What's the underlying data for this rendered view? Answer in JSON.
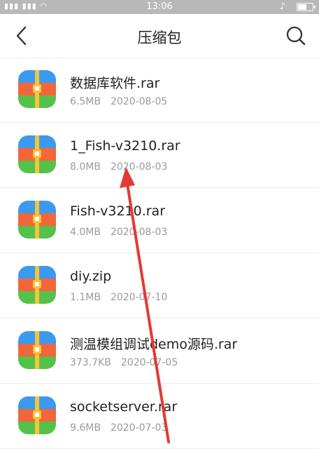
{
  "status": {
    "time": "13:06",
    "signal": "4G",
    "wifi": "wifi-icon",
    "mute": "bell-off-icon"
  },
  "header": {
    "title": "压缩包",
    "back_icon": "back-arrow-icon",
    "search_icon": "search-icon"
  },
  "files": [
    {
      "name": "数据库软件.rar",
      "size": "6.5MB",
      "date": "2020-08-05"
    },
    {
      "name": "1_Fish-v3210.rar",
      "size": "8.0MB",
      "date": "2020-08-03"
    },
    {
      "name": "Fish-v3210.rar",
      "size": "4.0MB",
      "date": "2020-08-03"
    },
    {
      "name": "diy.zip",
      "size": "1.1MB",
      "date": "2020-07-10"
    },
    {
      "name": "测温模组调试demo源码.rar",
      "size": "373.7KB",
      "date": "2020-07-05"
    },
    {
      "name": "socketserver.rar",
      "size": "9.6MB",
      "date": "2020-07-03"
    }
  ],
  "colors": {
    "accent_arrow": "#e53935",
    "icon_blue": "#3b9af0",
    "icon_orange": "#f2663a",
    "icon_green": "#54c24a",
    "icon_zip": "#f4c53a"
  }
}
